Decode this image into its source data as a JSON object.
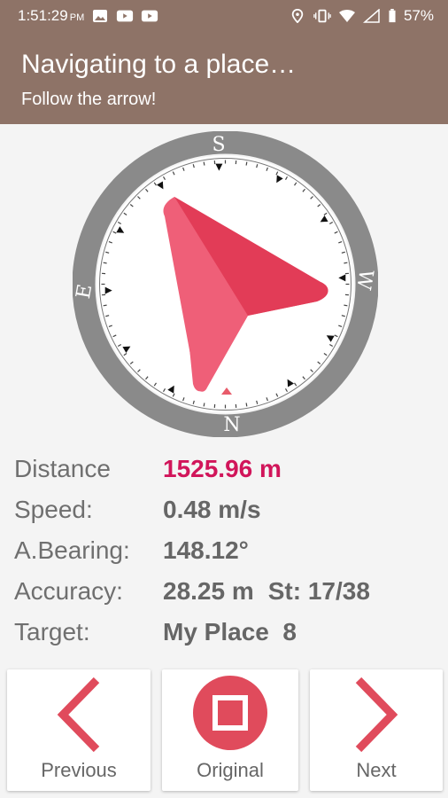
{
  "status_bar": {
    "time": "1:51:29",
    "ampm": "PM",
    "battery": "57%"
  },
  "app_bar": {
    "title": "Navigating to a place…",
    "subtitle": "Follow the arrow!"
  },
  "compass": {
    "cardinals": {
      "north": "N",
      "south": "S",
      "east": "E",
      "west": "W"
    },
    "heading_deg": 148.12
  },
  "info": {
    "distance_label": "Distance",
    "distance_value": "1525.96 m",
    "speed_label": "Speed:",
    "speed_value": "0.48 m/s",
    "bearing_label": "A.Bearing:",
    "bearing_value": "148.12°",
    "accuracy_label": "Accuracy:",
    "accuracy_value": "28.25 m",
    "satellites_value": "St: 17/38",
    "target_label": "Target:",
    "target_value": "My Place  8"
  },
  "buttons": {
    "previous": "Previous",
    "original": "Original",
    "next": "Next"
  },
  "colors": {
    "app_bar": "#8e7367",
    "accent": "#d1155a",
    "arrow_light": "#ef5f78",
    "arrow_dark": "#e23c57",
    "bezel": "#8a8a8a",
    "icon_red": "#e04b5c"
  }
}
